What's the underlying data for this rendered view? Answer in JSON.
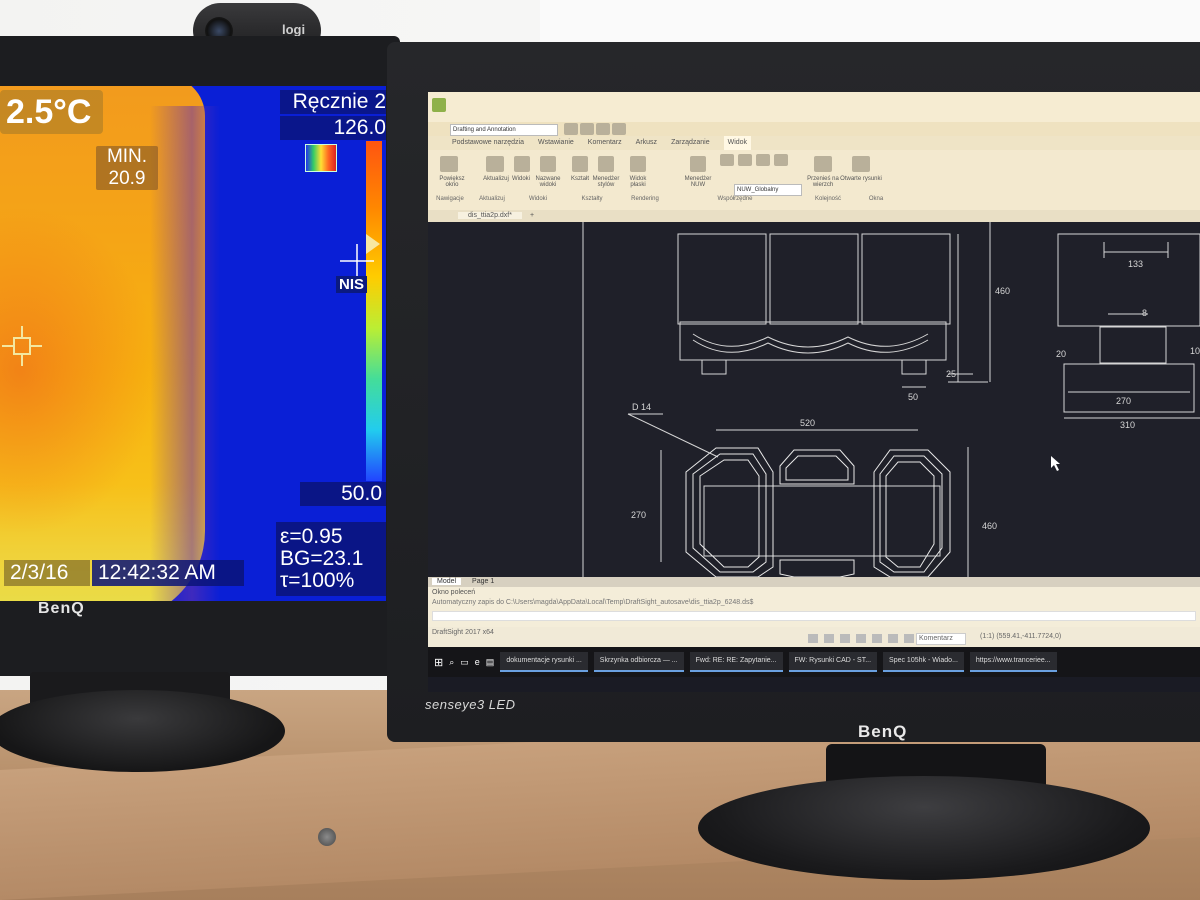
{
  "thermal": {
    "temp_main": "2.5°C",
    "min_label": "MIN.",
    "min_value": "20.9",
    "mode": "Ręcznie 2",
    "scale_max": "126.0",
    "spot_label": "NIS",
    "scale_min": "50.0",
    "emissivity": "ε=0.95",
    "background": "BG=23.1",
    "transmission": "τ=100%",
    "date": "2/3/16",
    "time": "12:42:32 AM"
  },
  "brands": {
    "left_monitor": "BenQ",
    "right_monitor": "BenQ",
    "right_series": "senseye3 LED",
    "webcam": "logi"
  },
  "cad": {
    "workspace": "Drafting and Annotation",
    "tabs": [
      "Podstawowe narzędzia",
      "Wstawianie",
      "Komentarz",
      "Arkusz",
      "Zarządzanie",
      "Widok"
    ],
    "ribbon_groups": [
      "Nawigacje",
      "Aktualizuj",
      "Widoki",
      "Kształty",
      "Rendering",
      "Współrzędne",
      "Kolejność",
      "Okna"
    ],
    "ribbon_labels": [
      "Powiększ okno",
      "Aktualizuj",
      "Widoki",
      "Nazwane widoki",
      "Kształt",
      "Menedżer stylów",
      "Widok płaski",
      "Menedżer NUW",
      "NUW_Globalny",
      "Przenieś na wierzch",
      "Otwarte rysunki"
    ],
    "document_tab": "dis_ttia2p.dxf*",
    "layout_tabs": [
      "Model",
      "Page 1"
    ],
    "command_title": "Okno poleceń",
    "command_line": "Automatyczny zapis do C:\\Users\\magda\\AppData\\Local\\Temp\\DraftSight_autosave\\dis_ttia2p_6248.ds$",
    "app_version": "DraftSight 2017 x64",
    "status_mode": "Komentarz",
    "coords": "(1:1)  (559.41,-411.7724,0)",
    "dims": {
      "d460_top": "460",
      "d25": "25",
      "d50": "50",
      "d133": "133",
      "d8": "8",
      "d20": "20",
      "d10": "10",
      "d270_right": "270",
      "d310": "310",
      "d14": "D 14",
      "d520": "520",
      "d270_left": "270",
      "d460_bottom": "460"
    },
    "taskbar": [
      "dokumentacje rysunki ...",
      "Skrzynka odbiorcza — ...",
      "Fwd: RE: RE: Zapytanie...",
      "FW: Rysunki CAD - ST...",
      "Spec 105hk - Wiado...",
      "https://www.tranceriee..."
    ]
  },
  "colors": {
    "thermal_background": "#0a1fd6",
    "cad_background": "#1f2029",
    "ribbon": "#f3e9cf"
  }
}
